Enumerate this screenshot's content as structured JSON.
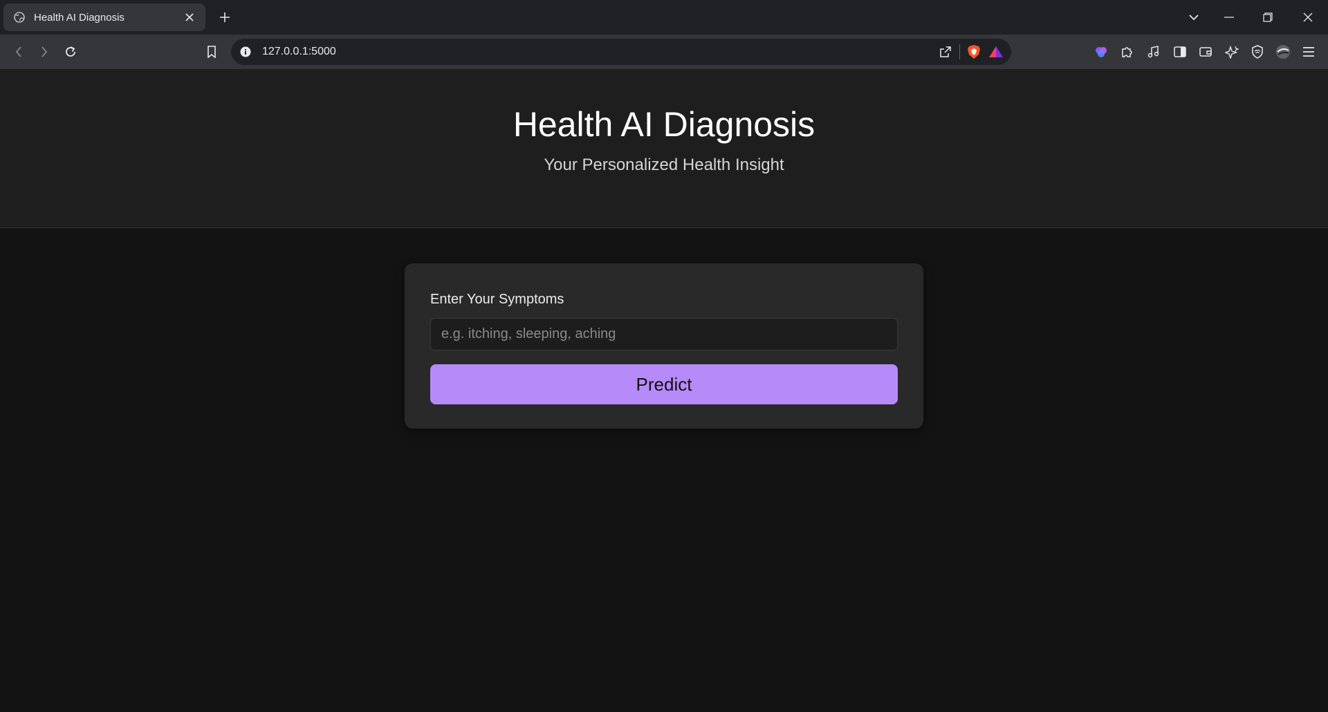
{
  "browser": {
    "tab_title": "Health AI Diagnosis",
    "url": "127.0.0.1:5000"
  },
  "header": {
    "title": "Health AI Diagnosis",
    "subtitle": "Your Personalized Health Insight"
  },
  "form": {
    "label": "Enter Your Symptoms",
    "input_value": "",
    "input_placeholder": "e.g. itching, sleeping, aching",
    "submit_label": "Predict"
  },
  "colors": {
    "accent": "#b78af9",
    "page_bg": "#131313",
    "header_bg": "#1e1e1e",
    "card_bg": "#292929"
  }
}
